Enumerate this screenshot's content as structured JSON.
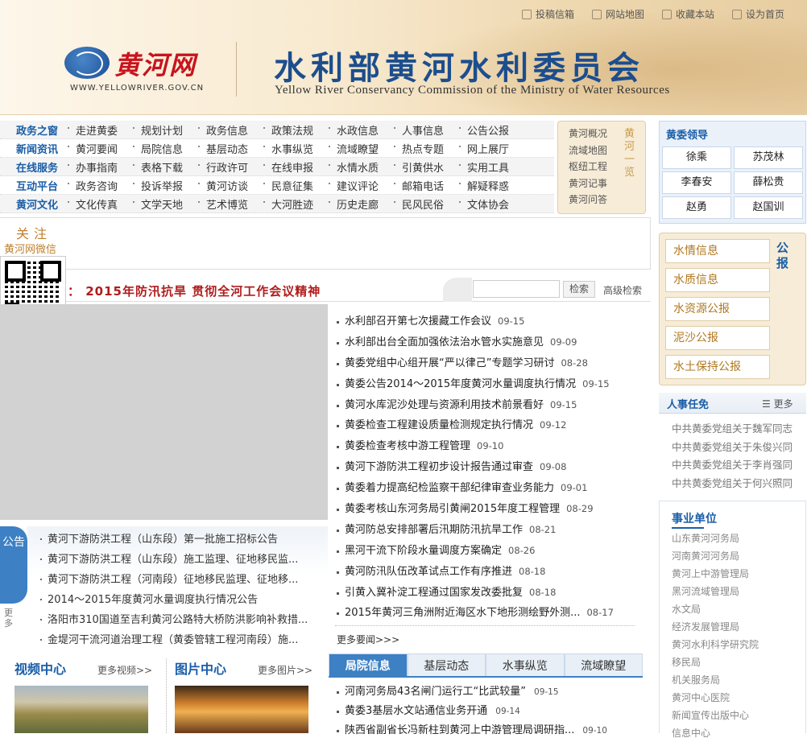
{
  "header": {
    "toplinks": [
      "投稿信箱",
      "网站地图",
      "收藏本站",
      "设为首页"
    ],
    "logo_cn": "黄河网",
    "logo_url": "WWW.YELLOWRIVER.GOV.CN",
    "title_cn": "水利部黄河水利委员会",
    "title_en": "Yellow River Conservancy Commission of the Ministry of Water Resources"
  },
  "nav": [
    {
      "cat": "政务之窗",
      "items": [
        "走进黄委",
        "规划计划",
        "政务信息",
        "政策法规",
        "水政信息",
        "人事信息",
        "公告公报"
      ]
    },
    {
      "cat": "新闻资讯",
      "items": [
        "黄河要闻",
        "局院信息",
        "基层动态",
        "水事纵览",
        "流域瞭望",
        "热点专题",
        "网上展厅"
      ]
    },
    {
      "cat": "在线服务",
      "items": [
        "办事指南",
        "表格下载",
        "行政许可",
        "在线申报",
        "水情水质",
        "引黄供水",
        "实用工具"
      ]
    },
    {
      "cat": "互动平台",
      "items": [
        "政务咨询",
        "投诉举报",
        "黄河访谈",
        "民意征集",
        "建议评论",
        "邮箱电话",
        "解疑释惑"
      ]
    },
    {
      "cat": "黄河文化",
      "items": [
        "文化传真",
        "文学天地",
        "艺术博览",
        "大河胜迹",
        "历史走廊",
        "民风民俗",
        "文体协会"
      ]
    }
  ],
  "overview": {
    "items": [
      "黄河概况",
      "流域地图",
      "枢纽工程",
      "黄河记事",
      "黄河问答"
    ],
    "side": "黄河一览"
  },
  "attention": {
    "title": "关注",
    "wechat": "黄河网微信"
  },
  "banner": {
    "text": "：  2015年防汛抗旱   贯彻全河工作会议精神"
  },
  "search": {
    "button": "检索",
    "advanced": "高级检索"
  },
  "notice": {
    "tab": "公告",
    "more": "更多",
    "items": [
      "黄河下游防洪工程（山东段）第一批施工招标公告",
      "黄河下游防洪工程（山东段）施工监理、征地移民监...",
      "黄河下游防洪工程（河南段）征地移民监理、征地移...",
      "2014～2015年度黄河水量调度执行情况公告",
      "洛阳市310国道至吉利黄河公路特大桥防洪影响补救措...",
      "金堤河干流河道治理工程（黄委管辖工程河南段）施..."
    ]
  },
  "news": {
    "items": [
      {
        "title": "水利部召开第七次援藏工作会议",
        "date": "09-15"
      },
      {
        "title": "水利部出台全面加强依法治水管水实施意见",
        "date": "09-09"
      },
      {
        "title": "黄委党组中心组开展“严以律己”专题学习研讨",
        "date": "08-28"
      },
      {
        "title": "黄委公告2014～2015年度黄河水量调度执行情况",
        "date": "09-15"
      },
      {
        "title": "黄河水库泥沙处理与资源利用技术前景看好",
        "date": "09-15"
      },
      {
        "title": "黄委检查工程建设质量检测规定执行情况",
        "date": "09-12"
      },
      {
        "title": "黄委检查考核中游工程管理",
        "date": "09-10"
      },
      {
        "title": "黄河下游防洪工程初步设计报告通过审查",
        "date": "09-08"
      },
      {
        "title": "黄委着力提高纪检监察干部纪律审查业务能力",
        "date": "09-01"
      },
      {
        "title": "黄委考核山东河务局引黄闸2015年度工程管理",
        "date": "08-29"
      },
      {
        "title": "黄河防总安排部署后汛期防汛抗旱工作",
        "date": "08-21"
      },
      {
        "title": "黑河干流下阶段水量调度方案确定",
        "date": "08-26"
      },
      {
        "title": "黄河防汛队伍改革试点工作有序推进",
        "date": "08-18"
      },
      {
        "title": "引黄入冀补淀工程通过国家发改委批复",
        "date": "08-18"
      },
      {
        "title": "2015年黄河三角洲附近海区水下地形测绘野外测...",
        "date": "08-17"
      }
    ],
    "more": "更多要闻>>>"
  },
  "tabs": {
    "labels": [
      "局院信息",
      "基层动态",
      "水事纵览",
      "流域瞭望"
    ],
    "items": [
      {
        "title": "河南河务局43名闸门运行工“比武较量”",
        "date": "09-15"
      },
      {
        "title": "黄委3基层水文站通信业务开通",
        "date": "09-14"
      },
      {
        "title": "陕西省副省长冯新柱到黄河上中游管理局调研指...",
        "date": "09-10"
      }
    ]
  },
  "media": {
    "video_title": "视频中心",
    "video_more": "更多视频>>",
    "photo_title": "图片中心",
    "photo_more": "更多图片>>"
  },
  "leaders": {
    "title": "黄委领导",
    "names": [
      "徐乘",
      "苏茂林",
      "李春安",
      "薛松贵",
      "赵勇",
      "赵国训"
    ]
  },
  "public": {
    "items": [
      "水情信息",
      "水质信息",
      "水资源公报",
      "泥沙公报",
      "水土保持公报"
    ],
    "side": "公报"
  },
  "personnel": {
    "title": "人事任免",
    "more": "更多",
    "items": [
      "中共黄委党组关于魏军同志",
      "中共黄委党组关于朱俊兴同",
      "中共黄委党组关于李肖强同",
      "中共黄委党组关于何兴照同"
    ]
  },
  "units": {
    "title": "事业单位",
    "items": [
      "山东黄河河务局",
      "河南黄河河务局",
      "黄河上中游管理局",
      "黑河流域管理局",
      "水文局",
      "经济发展管理局",
      "黄河水利科学研究院",
      "移民局",
      "机关服务局",
      "黄河中心医院",
      "新闻宣传出版中心",
      "信息中心"
    ]
  }
}
